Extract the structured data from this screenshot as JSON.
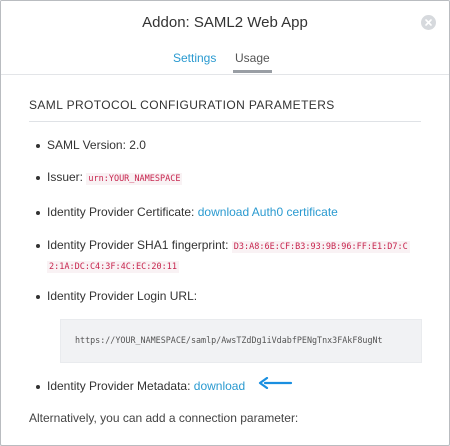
{
  "modal": {
    "title": "Addon: SAML2 Web App",
    "tabs": [
      {
        "label": "Settings"
      },
      {
        "label": "Usage"
      }
    ]
  },
  "section": {
    "title": "SAML PROTOCOL CONFIGURATION PARAMETERS"
  },
  "items": {
    "version": {
      "label": "SAML Version:",
      "value": "2.0"
    },
    "issuer": {
      "label": "Issuer:",
      "value": "urn:YOUR_NAMESPACE"
    },
    "certificate": {
      "label": "Identity Provider Certificate:",
      "link": "download Auth0 certificate"
    },
    "fingerprint": {
      "label": "Identity Provider SHA1 fingerprint:",
      "value_line1": "D3:A8:6E:CF:B3:93:9B:96:FF:E1:D7:C",
      "value_line2": "2:1A:DC:C4:3F:4C:EC:20:11"
    },
    "login_url": {
      "label": "Identity Provider Login URL:",
      "value": "https://YOUR_NAMESPACE/samlp/AwsTZdDg1iVdabfPENgTnx3FAkF8ugNt"
    },
    "metadata": {
      "label": "Identity Provider Metadata:",
      "link": "download"
    }
  },
  "footer": {
    "text": "Alternatively, you can add a connection parameter:"
  },
  "colors": {
    "link": "#2a9ad0",
    "arrow": "#1a8fe0",
    "code": "#c7254e"
  },
  "icons": [
    "close-icon",
    "arrow-left-icon"
  ]
}
